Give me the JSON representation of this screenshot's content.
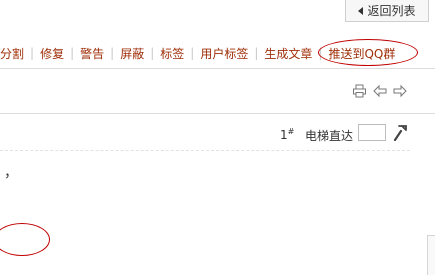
{
  "header": {
    "back_label": "返回列表"
  },
  "admin_bar": {
    "items": [
      "分割",
      "修复",
      "警告",
      "屏蔽",
      "标签",
      "用户标签",
      "生成文章"
    ],
    "highlighted": "推送到QQ群"
  },
  "toolbar": {
    "icons": [
      "print-icon",
      "prev-thread-icon",
      "next-thread-icon"
    ]
  },
  "post": {
    "floor_number": "1",
    "floor_suffix": "#",
    "elevator_label": "电梯直达",
    "elevator_input_value": "",
    "body_text": "，"
  },
  "colors": {
    "link": "#a0300a",
    "annotation": "#c00000",
    "separator": "#c8c8c8"
  }
}
